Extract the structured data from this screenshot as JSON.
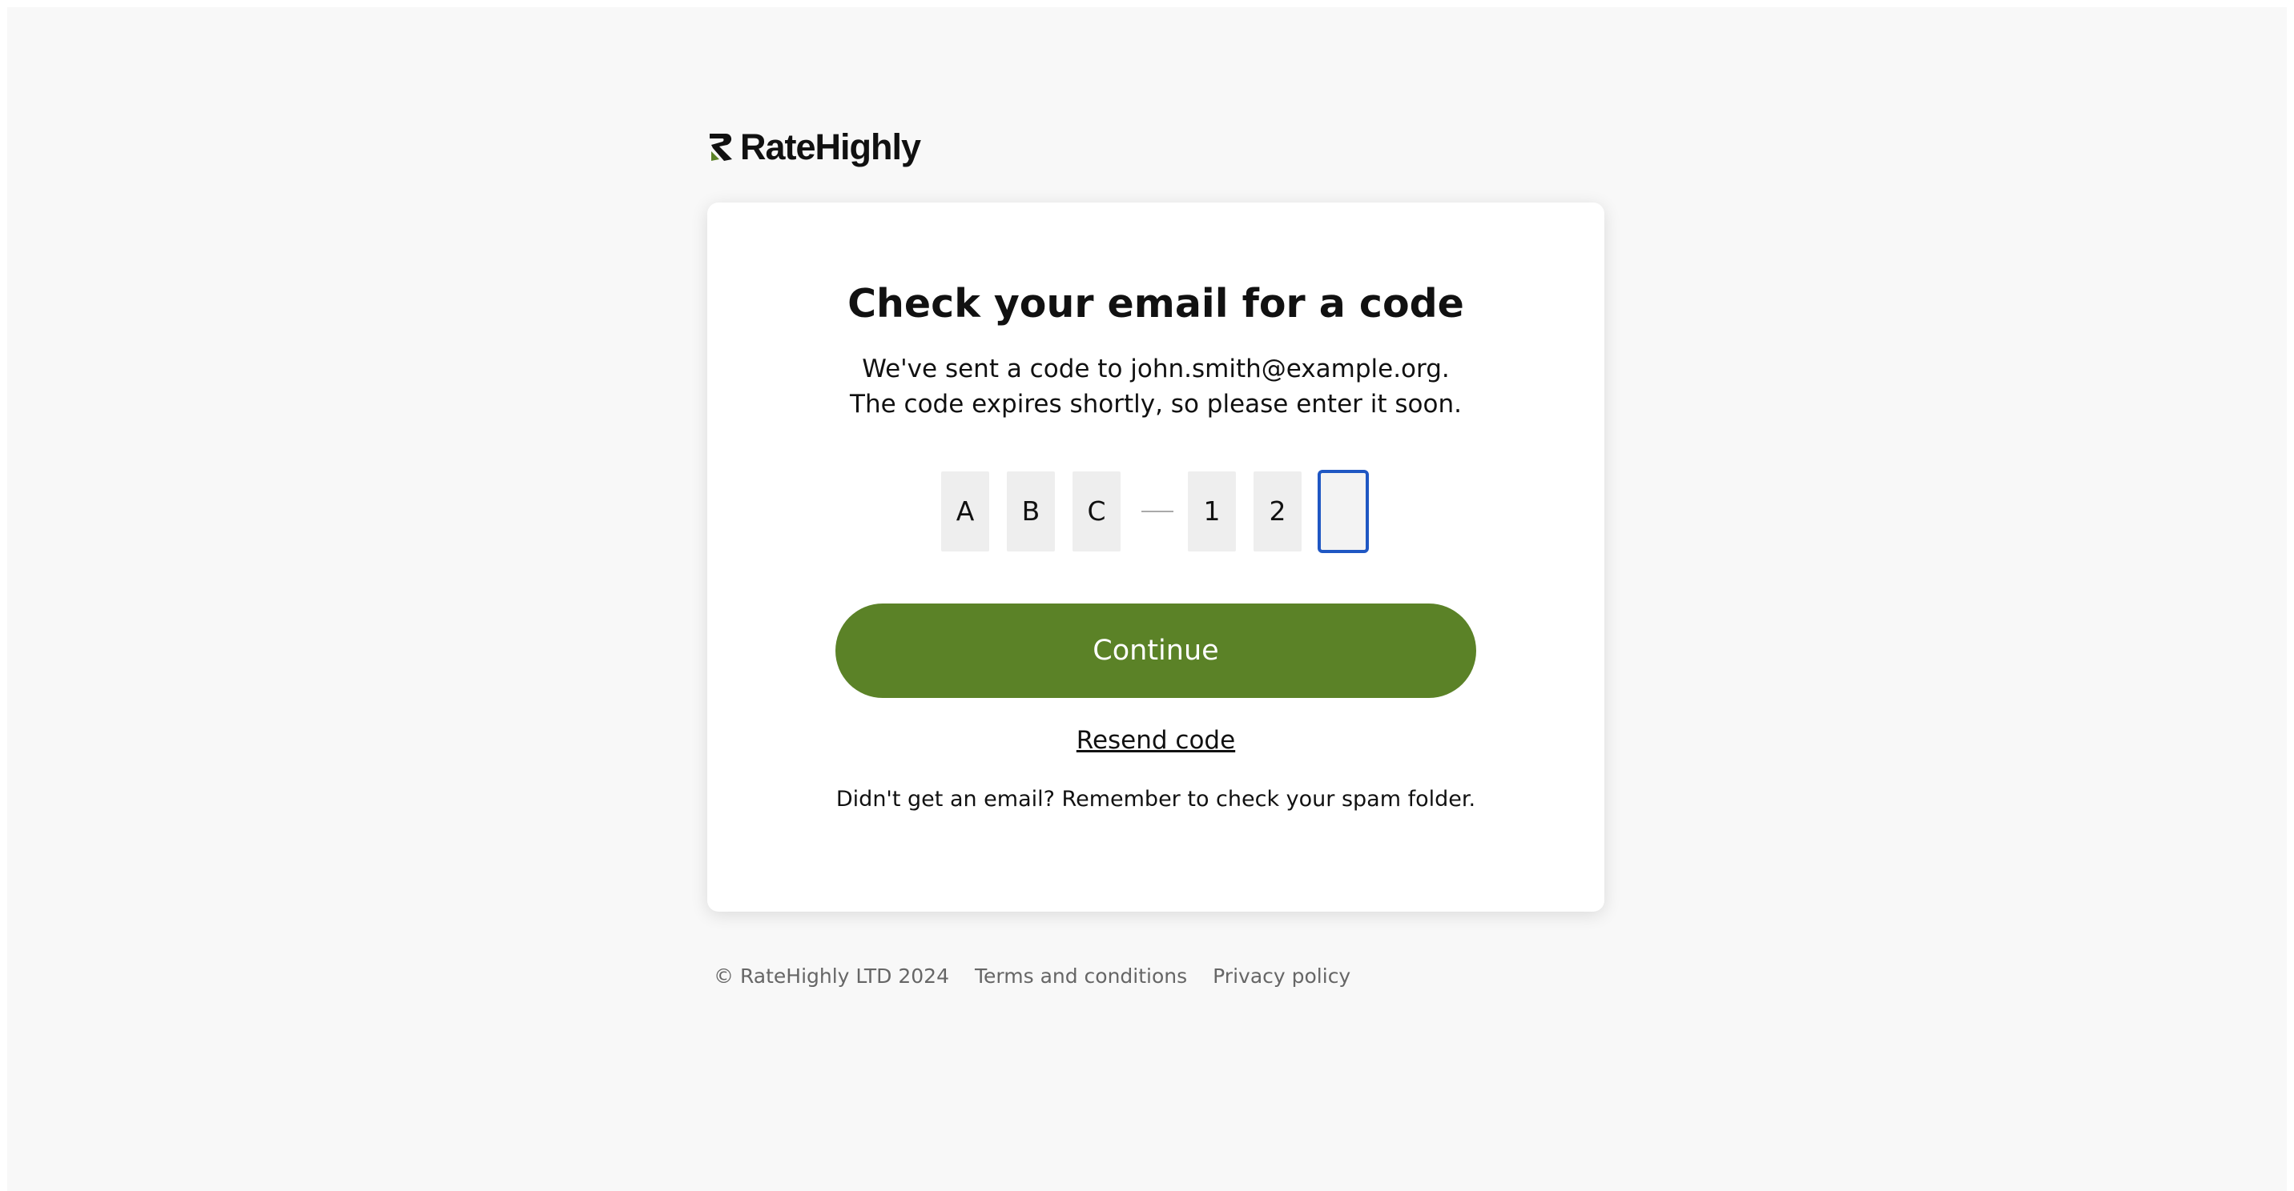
{
  "brand": {
    "name": "RateHighly",
    "accent_color": "#5b8227",
    "focus_color": "#1f57c3"
  },
  "card": {
    "title": "Check your email for a code",
    "description_line1": "We've sent a code to john.smith@example.org.",
    "description_line2": "The code expires shortly, so please enter it soon.",
    "code_chars": [
      "A",
      "B",
      "C",
      "1",
      "2",
      ""
    ],
    "continue_label": "Continue",
    "resend_label": "Resend code",
    "spam_note": "Didn't get an email? Remember to check your spam folder."
  },
  "footer": {
    "copyright": "© RateHighly LTD 2024",
    "terms_label": "Terms and conditions",
    "privacy_label": "Privacy policy"
  }
}
